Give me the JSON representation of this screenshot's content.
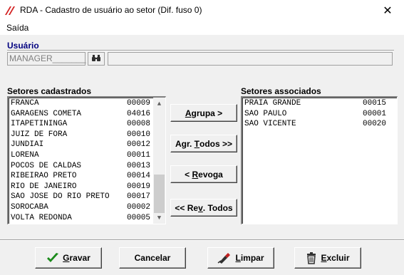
{
  "window": {
    "title": "RDA - Cadastro de usuário ao setor (Dif. fuso 0)",
    "close_symbol": "✕"
  },
  "menu": {
    "items": [
      "Saída"
    ]
  },
  "usuario": {
    "label": "Usuário",
    "code_value": "MANAGER_______",
    "name_value": ""
  },
  "setores_cadastrados": {
    "label": "Setores cadastrados",
    "items": [
      {
        "name": "FRANCA",
        "code": "00009"
      },
      {
        "name": "GARAGENS COMETA",
        "code": "04016"
      },
      {
        "name": "ITAPETININGA",
        "code": "00008"
      },
      {
        "name": "JUIZ DE FORA",
        "code": "00010"
      },
      {
        "name": "JUNDIAI",
        "code": "00012"
      },
      {
        "name": "LORENA",
        "code": "00011"
      },
      {
        "name": "POCOS DE CALDAS",
        "code": "00013"
      },
      {
        "name": "RIBEIRAO PRETO",
        "code": "00014"
      },
      {
        "name": "RIO DE JANEIRO",
        "code": "00019"
      },
      {
        "name": "SAO JOSE DO RIO PRETO",
        "code": "00017"
      },
      {
        "name": "SOROCABA",
        "code": "00002"
      },
      {
        "name": "VOLTA REDONDA",
        "code": "00005"
      }
    ]
  },
  "setores_associados": {
    "label": "Setores associados",
    "items": [
      {
        "name": "PRAIA GRANDE",
        "code": "00015"
      },
      {
        "name": "SAO PAULO",
        "code": "00001"
      },
      {
        "name": "SAO VICENTE",
        "code": "00020"
      }
    ]
  },
  "actions": {
    "agrupa": {
      "pre": "",
      "hot": "A",
      "post": "grupa >"
    },
    "agr_todos": {
      "pre": "Agr. ",
      "hot": "T",
      "post": "odos >>"
    },
    "revoga": {
      "pre": "< ",
      "hot": "R",
      "post": "evoga"
    },
    "rev_todos": {
      "pre": "<< Re",
      "hot": "v",
      "post": ". Todos"
    }
  },
  "footer": {
    "gravar": {
      "hot": "G",
      "post": "ravar"
    },
    "cancelar": {
      "label": "Cancelar"
    },
    "limpar": {
      "hot": "L",
      "post": "impar"
    },
    "excluir": {
      "hot": "E",
      "post": "xcluir"
    }
  },
  "colors": {
    "usuario_label": "#00007f",
    "check_green": "#1a8a1a",
    "brand_red": "#d21f1f"
  }
}
